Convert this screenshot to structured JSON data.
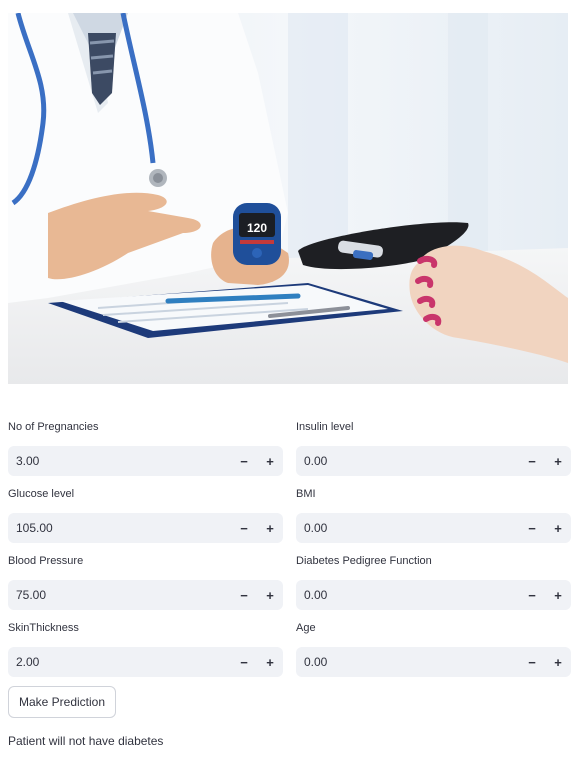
{
  "form": {
    "fields": [
      {
        "label": "No of Pregnancies",
        "value": "3.00"
      },
      {
        "label": "Insulin level",
        "value": "0.00"
      },
      {
        "label": "Glucose level",
        "value": "105.00"
      },
      {
        "label": "BMI",
        "value": "0.00"
      },
      {
        "label": "Blood Pressure",
        "value": "75.00"
      },
      {
        "label": "Diabetes Pedigree Function",
        "value": "0.00"
      },
      {
        "label": "SkinThickness",
        "value": "2.00"
      },
      {
        "label": "Age",
        "value": "0.00"
      }
    ],
    "decrement_symbol": "−",
    "increment_symbol": "+"
  },
  "hero": {
    "glucometer_reading": "120"
  },
  "actions": {
    "predict_label": "Make Prediction"
  },
  "result": {
    "text": "Patient will not have diabetes"
  },
  "colors": {
    "input_bg": "#f0f2f6",
    "text": "#31333f",
    "button_border": "#d0d3da"
  }
}
